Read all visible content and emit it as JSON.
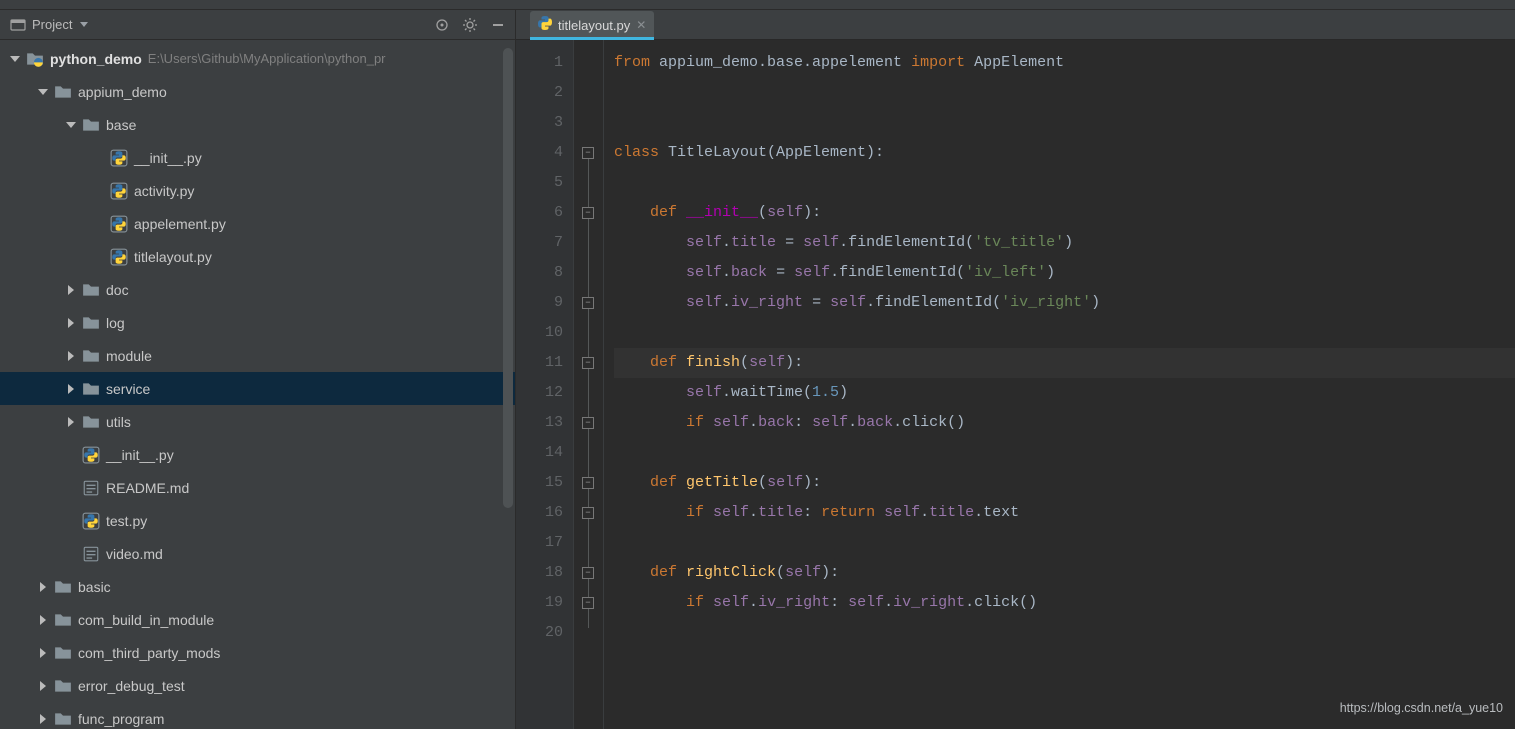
{
  "sidebar": {
    "viewLabel": "Project",
    "root": {
      "label": "python_demo",
      "path": "E:\\Users\\Github\\MyApplication\\python_pr"
    },
    "tree": [
      {
        "depth": 0,
        "arrow": "down",
        "icon": "py-root",
        "label": "python_demo",
        "path": "E:\\Users\\Github\\MyApplication\\python_pr",
        "root": true
      },
      {
        "depth": 1,
        "arrow": "down",
        "icon": "folder",
        "label": "appium_demo"
      },
      {
        "depth": 2,
        "arrow": "down",
        "icon": "folder",
        "label": "base"
      },
      {
        "depth": 3,
        "arrow": "none",
        "icon": "py",
        "label": "__init__.py"
      },
      {
        "depth": 3,
        "arrow": "none",
        "icon": "py",
        "label": "activity.py"
      },
      {
        "depth": 3,
        "arrow": "none",
        "icon": "py",
        "label": "appelement.py"
      },
      {
        "depth": 3,
        "arrow": "none",
        "icon": "py",
        "label": "titlelayout.py"
      },
      {
        "depth": 2,
        "arrow": "right",
        "icon": "folder",
        "label": "doc"
      },
      {
        "depth": 2,
        "arrow": "right",
        "icon": "folder",
        "label": "log"
      },
      {
        "depth": 2,
        "arrow": "right",
        "icon": "folder",
        "label": "module"
      },
      {
        "depth": 2,
        "arrow": "right",
        "icon": "folder",
        "label": "service",
        "selected": true
      },
      {
        "depth": 2,
        "arrow": "right",
        "icon": "folder",
        "label": "utils"
      },
      {
        "depth": 2,
        "arrow": "none",
        "icon": "py",
        "label": "__init__.py"
      },
      {
        "depth": 2,
        "arrow": "none",
        "icon": "md",
        "label": "README.md"
      },
      {
        "depth": 2,
        "arrow": "none",
        "icon": "py",
        "label": "test.py"
      },
      {
        "depth": 2,
        "arrow": "none",
        "icon": "md",
        "label": "video.md"
      },
      {
        "depth": 1,
        "arrow": "right",
        "icon": "folder",
        "label": "basic"
      },
      {
        "depth": 1,
        "arrow": "right",
        "icon": "folder",
        "label": "com_build_in_module"
      },
      {
        "depth": 1,
        "arrow": "right",
        "icon": "folder",
        "label": "com_third_party_mods"
      },
      {
        "depth": 1,
        "arrow": "right",
        "icon": "folder",
        "label": "error_debug_test"
      },
      {
        "depth": 1,
        "arrow": "right",
        "icon": "folder",
        "label": "func_program"
      }
    ]
  },
  "editor": {
    "tab": {
      "label": "titlelayout.py"
    },
    "lineCount": 20,
    "highlightLine": 11,
    "code": {
      "1": [
        {
          "t": "from ",
          "c": "kw-orange"
        },
        {
          "t": "appium_demo.base.appelement "
        },
        {
          "t": "import ",
          "c": "kw-orange"
        },
        {
          "t": "AppElement"
        }
      ],
      "2": [],
      "3": [],
      "4": [
        {
          "t": "class ",
          "c": "kw-orange"
        },
        {
          "t": "TitleLayout(AppElement):"
        }
      ],
      "5": [],
      "6": [
        {
          "t": "    "
        },
        {
          "t": "def ",
          "c": "kw-orange"
        },
        {
          "t": "__init__",
          "c": "init-dunder"
        },
        {
          "t": "("
        },
        {
          "t": "self",
          "c": "kw-purple"
        },
        {
          "t": "):"
        }
      ],
      "7": [
        {
          "t": "        "
        },
        {
          "t": "self",
          "c": "kw-purple"
        },
        {
          "t": "."
        },
        {
          "t": "title",
          "c": "kw-purple"
        },
        {
          "t": " = "
        },
        {
          "t": "self",
          "c": "kw-purple"
        },
        {
          "t": ".findElementId("
        },
        {
          "t": "'tv_title'",
          "c": "kw-green"
        },
        {
          "t": ")"
        }
      ],
      "8": [
        {
          "t": "        "
        },
        {
          "t": "self",
          "c": "kw-purple"
        },
        {
          "t": "."
        },
        {
          "t": "back",
          "c": "kw-purple"
        },
        {
          "t": " = "
        },
        {
          "t": "self",
          "c": "kw-purple"
        },
        {
          "t": ".findElementId("
        },
        {
          "t": "'iv_left'",
          "c": "kw-green"
        },
        {
          "t": ")"
        }
      ],
      "9": [
        {
          "t": "        "
        },
        {
          "t": "self",
          "c": "kw-purple"
        },
        {
          "t": "."
        },
        {
          "t": "iv_right",
          "c": "kw-purple"
        },
        {
          "t": " = "
        },
        {
          "t": "self",
          "c": "kw-purple"
        },
        {
          "t": ".findElementId("
        },
        {
          "t": "'iv_right'",
          "c": "kw-green"
        },
        {
          "t": ")"
        }
      ],
      "10": [],
      "11": [
        {
          "t": "    "
        },
        {
          "t": "def ",
          "c": "kw-orange"
        },
        {
          "t": "finish",
          "c": "kw-yellow"
        },
        {
          "t": "("
        },
        {
          "t": "self",
          "c": "kw-purple"
        },
        {
          "t": "):"
        }
      ],
      "12": [
        {
          "t": "        "
        },
        {
          "t": "self",
          "c": "kw-purple"
        },
        {
          "t": ".waitTime("
        },
        {
          "t": "1.5",
          "c": "num"
        },
        {
          "t": ")"
        }
      ],
      "13": [
        {
          "t": "        "
        },
        {
          "t": "if ",
          "c": "kw-orange"
        },
        {
          "t": "self",
          "c": "kw-purple"
        },
        {
          "t": "."
        },
        {
          "t": "back",
          "c": "kw-purple"
        },
        {
          "t": ": "
        },
        {
          "t": "self",
          "c": "kw-purple"
        },
        {
          "t": "."
        },
        {
          "t": "back",
          "c": "kw-purple"
        },
        {
          "t": ".click()"
        }
      ],
      "14": [],
      "15": [
        {
          "t": "    "
        },
        {
          "t": "def ",
          "c": "kw-orange"
        },
        {
          "t": "getTitle",
          "c": "kw-yellow"
        },
        {
          "t": "("
        },
        {
          "t": "self",
          "c": "kw-purple"
        },
        {
          "t": "):"
        }
      ],
      "16": [
        {
          "t": "        "
        },
        {
          "t": "if ",
          "c": "kw-orange"
        },
        {
          "t": "self",
          "c": "kw-purple"
        },
        {
          "t": "."
        },
        {
          "t": "title",
          "c": "kw-purple"
        },
        {
          "t": ": "
        },
        {
          "t": "return ",
          "c": "kw-orange"
        },
        {
          "t": "self",
          "c": "kw-purple"
        },
        {
          "t": "."
        },
        {
          "t": "title",
          "c": "kw-purple"
        },
        {
          "t": ".text"
        }
      ],
      "17": [],
      "18": [
        {
          "t": "    "
        },
        {
          "t": "def ",
          "c": "kw-orange"
        },
        {
          "t": "rightClick",
          "c": "kw-yellow"
        },
        {
          "t": "("
        },
        {
          "t": "self",
          "c": "kw-purple"
        },
        {
          "t": "):"
        }
      ],
      "19": [
        {
          "t": "        "
        },
        {
          "t": "if ",
          "c": "kw-orange"
        },
        {
          "t": "self",
          "c": "kw-purple"
        },
        {
          "t": "."
        },
        {
          "t": "iv_right",
          "c": "kw-purple"
        },
        {
          "t": ": "
        },
        {
          "t": "self",
          "c": "kw-purple"
        },
        {
          "t": "."
        },
        {
          "t": "iv_right",
          "c": "kw-purple"
        },
        {
          "t": ".click()"
        }
      ],
      "20": []
    },
    "foldMarkers": [
      4,
      6,
      9,
      11,
      13,
      15,
      16,
      18,
      19
    ],
    "foldLines": [
      [
        4,
        20
      ],
      [
        6,
        9
      ],
      [
        11,
        13
      ],
      [
        15,
        16
      ],
      [
        18,
        19
      ]
    ]
  },
  "footer": {
    "url": "https://blog.csdn.net/a_yue10"
  }
}
